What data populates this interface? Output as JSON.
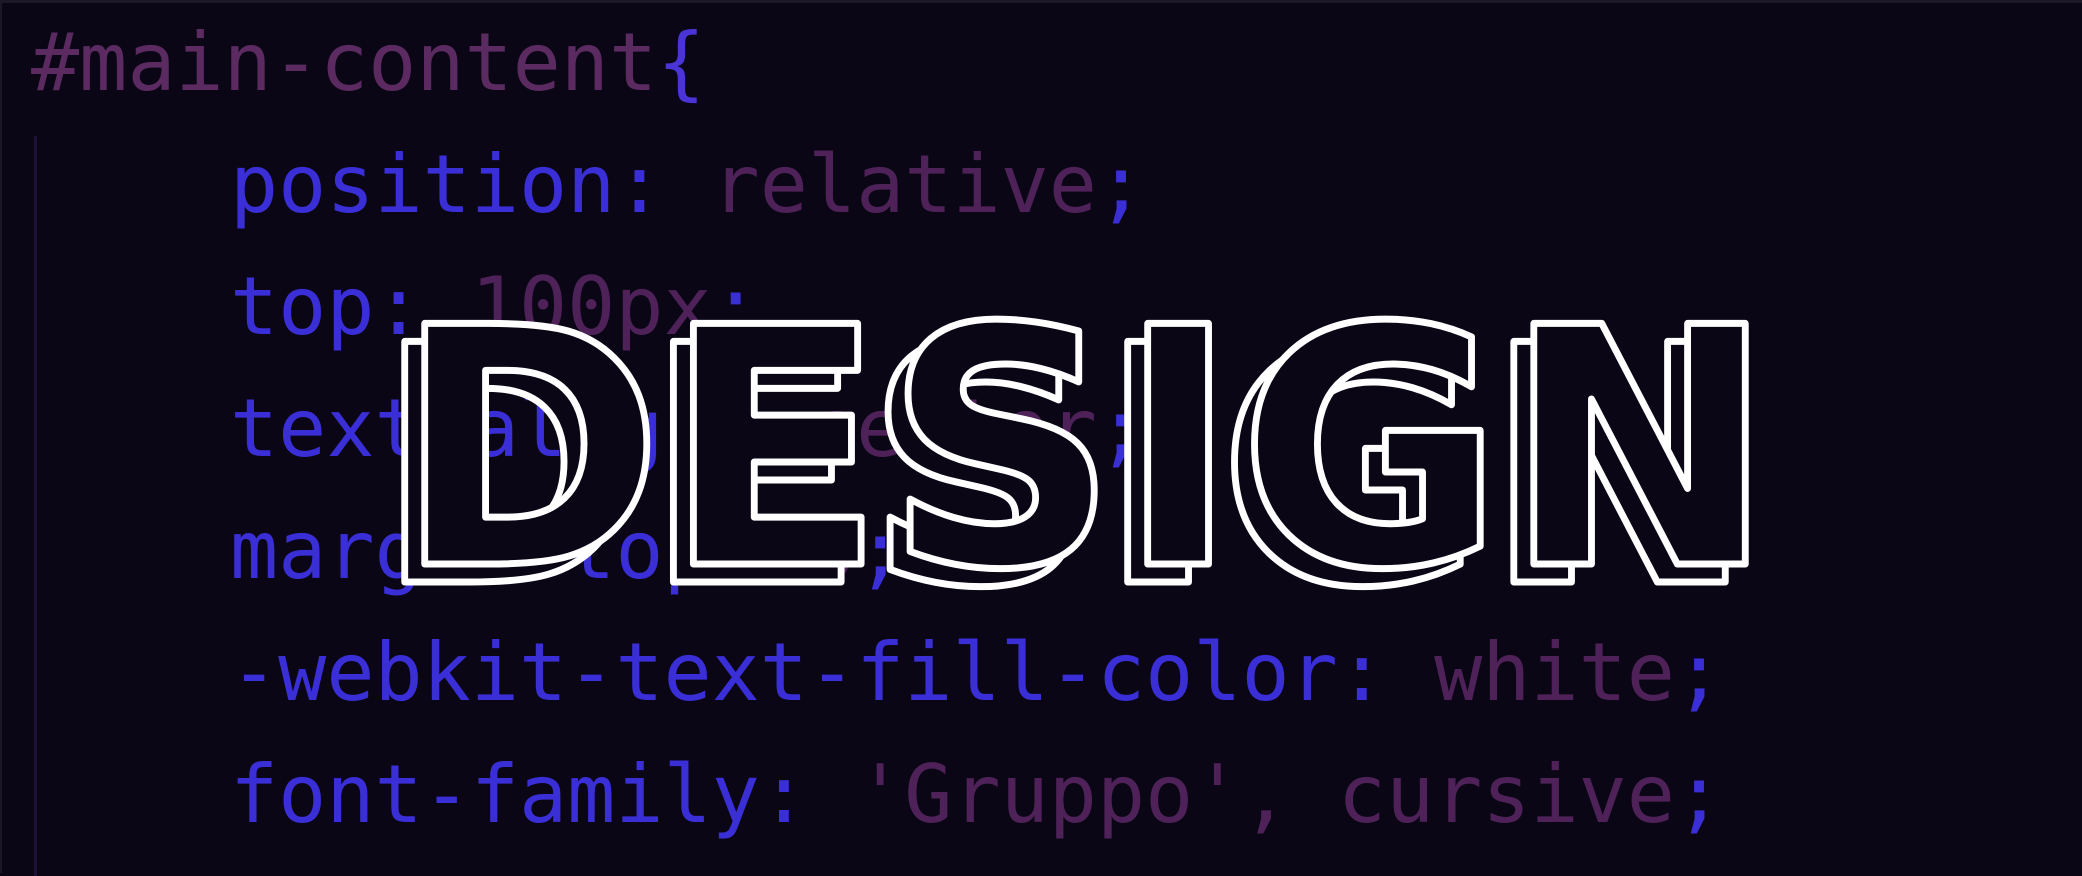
{
  "code": {
    "selector": "#main-content",
    "open_brace": "{",
    "declarations": [
      {
        "property": "position",
        "value": "relative"
      },
      {
        "property": "top",
        "value": "100px"
      },
      {
        "property": "text-align",
        "value": "center"
      },
      {
        "property": "margin-top",
        "value": "0"
      },
      {
        "property": "-webkit-text-fill-color",
        "value": "white"
      },
      {
        "property": "font-family",
        "value": "'Gruppo', cursive"
      }
    ]
  },
  "overlay": {
    "word": "DESIGN"
  },
  "colors": {
    "background": "#0b0616",
    "selector": "#5a2a60",
    "property": "#3a2ed6",
    "value": "#4e2258",
    "overlay_stroke": "#ffffff"
  }
}
